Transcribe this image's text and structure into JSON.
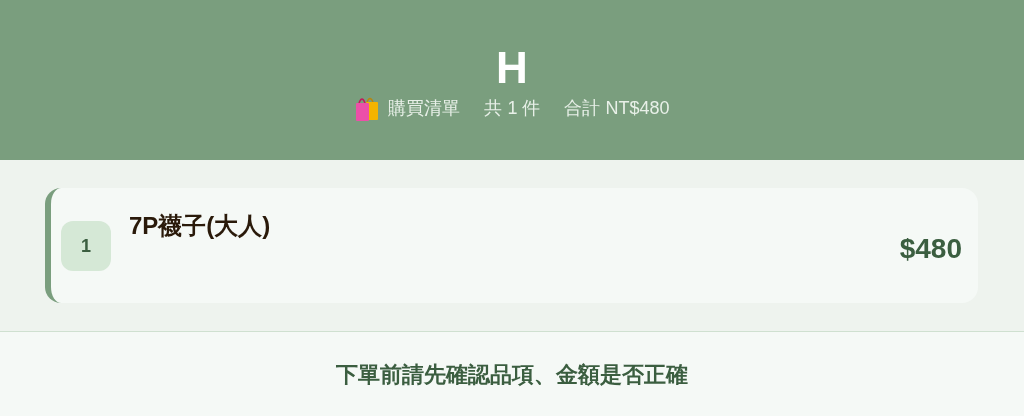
{
  "header": {
    "title": "H",
    "summary": [
      {
        "text": "購買清單"
      },
      {
        "text": "共 1 件"
      },
      {
        "text": "合計 NT$480"
      }
    ]
  },
  "items": [
    {
      "index": "1",
      "name": "7P襪子(大人)",
      "price": "$480"
    }
  ],
  "footer": {
    "notice": "下單前請先確認品項、金額是否正確"
  }
}
